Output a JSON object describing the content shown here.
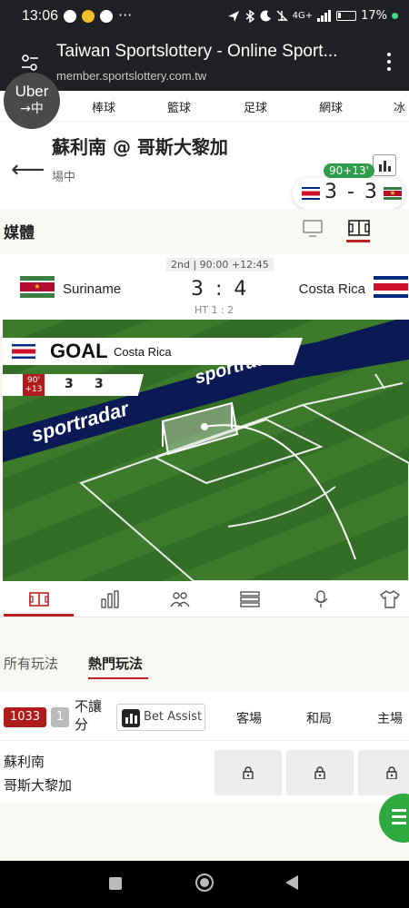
{
  "status_bar": {
    "time": "13:06",
    "battery": "17%",
    "network": "4G+"
  },
  "browser": {
    "title": "Taiwan Sportslottery - Online Sport...",
    "url": "member.sportslottery.com.tw"
  },
  "uber_bubble": {
    "label": "Uber",
    "partial_text": "中"
  },
  "sport_tabs": [
    "棒球",
    "籃球",
    "足球",
    "網球",
    "冰"
  ],
  "match": {
    "title": "蘇利南 @ 哥斯大黎加",
    "status": "場中",
    "time_pill": "90+13'",
    "bubble_score": "3 - 3"
  },
  "media": {
    "label": "媒體"
  },
  "scoreboard": {
    "period": "2nd | 90:00 +12:45",
    "home_team": "Suriname",
    "away_team": "Costa Rica",
    "score": "3 : 4",
    "half_time": "HT 1 : 2"
  },
  "pitch": {
    "event": "GOAL",
    "event_team": "Costa Rica",
    "minute": [
      "90'",
      "+13"
    ],
    "home_score": "3",
    "away_score": "3",
    "ad_text": "sportradar"
  },
  "bet_tabs": [
    "所有玩法",
    "熱門玩法"
  ],
  "market": {
    "code": "1033",
    "number": "1",
    "name": "不讓分",
    "bet_assist": "Bet Assist",
    "columns": [
      "客場",
      "和局",
      "主場"
    ]
  },
  "odds_row": {
    "team1": "蘇利南",
    "team2": "哥斯大黎加"
  },
  "colors": {
    "accent_red": "#b01c1c",
    "live_green": "#2e9e4a",
    "pitch_green": "#3d7a2c",
    "page_bg": "#faf8f2"
  }
}
